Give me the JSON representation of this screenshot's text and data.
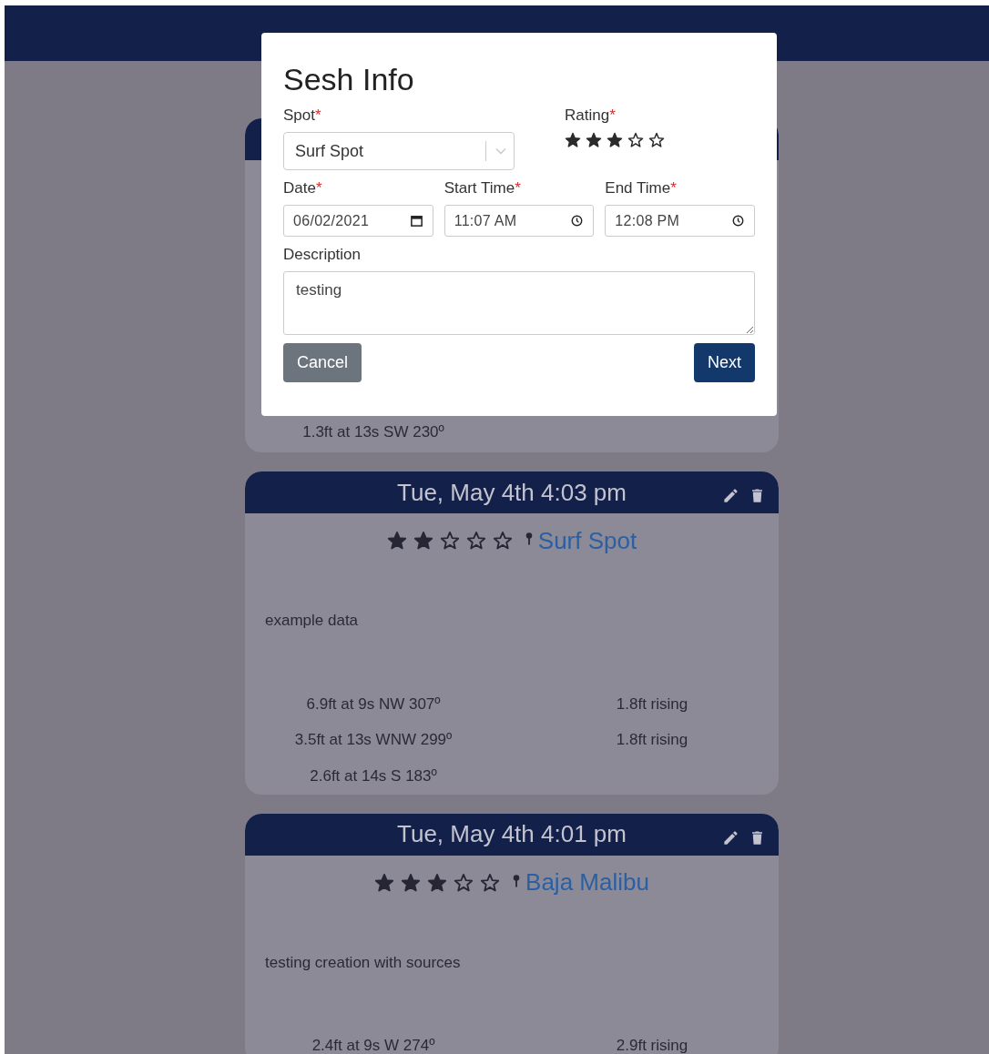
{
  "modal": {
    "title": "Sesh Info",
    "spot": {
      "label": "Spot",
      "required_mark": "*",
      "value": "Surf Spot"
    },
    "rating": {
      "label": "Rating",
      "required_mark": "*",
      "stars": 3
    },
    "date": {
      "label": "Date",
      "required_mark": "*",
      "value": "06/02/2021"
    },
    "start_time": {
      "label": "Start Time",
      "required_mark": "*",
      "value": "11:07 AM"
    },
    "end_time": {
      "label": "End Time",
      "required_mark": "*",
      "value": "12:08 PM"
    },
    "description": {
      "label": "Description",
      "value": "testing"
    },
    "buttons": [
      {
        "label": "Cancel",
        "kind": "secondary"
      },
      {
        "label": "Next",
        "kind": "primary"
      }
    ]
  },
  "sessions": [
    {
      "swells": [
        {
          "swell": "1.3ft at 13s SW 230º"
        }
      ]
    },
    {
      "title": "Tue, May 4th 4:03 pm",
      "stars": 2,
      "spot": "Surf Spot",
      "description": "example data",
      "swells": [
        {
          "swell": "6.9ft at 9s NW 307º",
          "tide": "1.8ft rising"
        },
        {
          "swell": "3.5ft at 13s WNW 299º",
          "tide": "1.8ft rising"
        },
        {
          "swell": "2.6ft at 14s S 183º"
        }
      ]
    },
    {
      "title": "Tue, May 4th 4:01 pm",
      "stars": 3,
      "spot": "Baja Malibu",
      "description": "testing creation with sources",
      "swells": [
        {
          "swell": "2.4ft at 9s W 274º",
          "tide": "2.9ft rising"
        }
      ]
    }
  ]
}
